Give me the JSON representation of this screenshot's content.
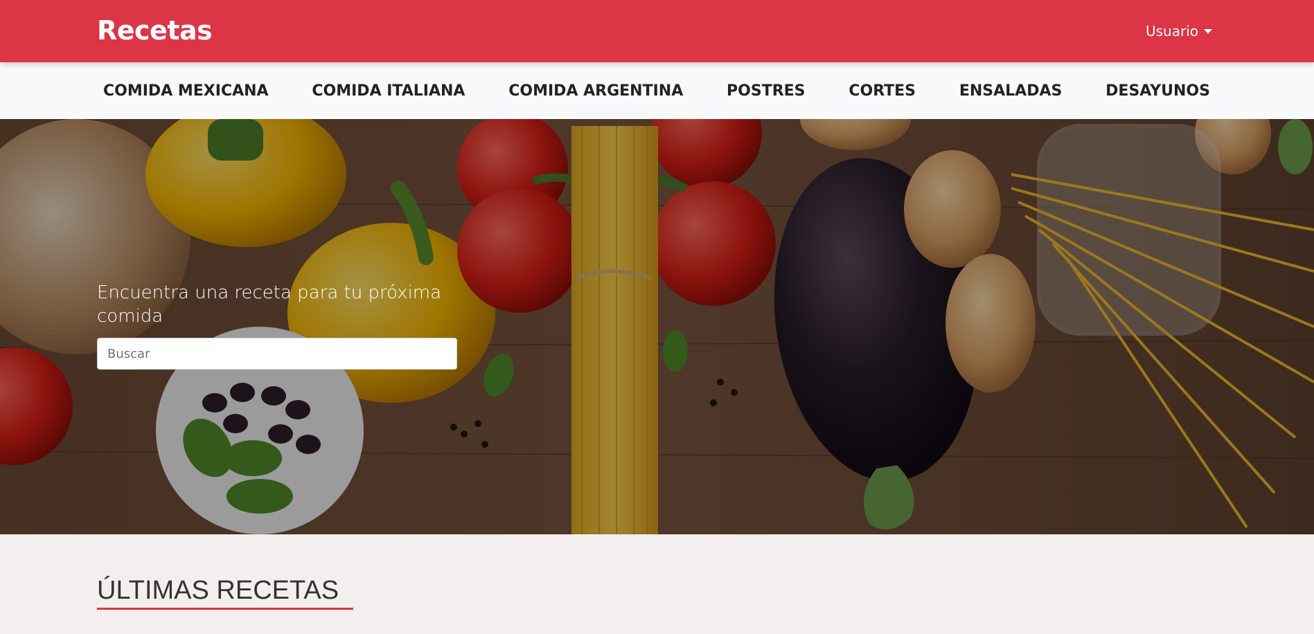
{
  "navbar": {
    "brand": "Recetas",
    "user_menu_label": "Usuario"
  },
  "categories": [
    "COMIDA MEXICANA",
    "COMIDA ITALIANA",
    "COMIDA ARGENTINA",
    "POSTRES",
    "CORTES",
    "ENSALADAS",
    "DESAYUNOS"
  ],
  "hero": {
    "title": "Encuentra una receta para tu próxima comida",
    "search": {
      "placeholder": "Buscar",
      "value": ""
    }
  },
  "latest": {
    "title": "ÚLTIMAS RECETAS"
  },
  "colors": {
    "primary": "#dc3545",
    "nav_bg": "#f8f9fa",
    "page_bg": "#f3efee"
  }
}
